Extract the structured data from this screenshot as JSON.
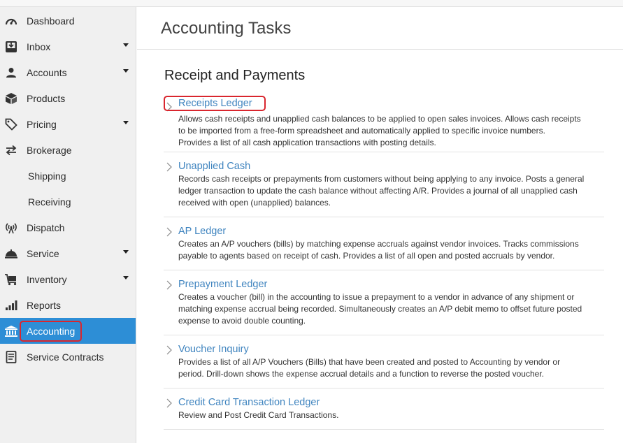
{
  "sidebar": {
    "items": [
      {
        "label": "Dashboard",
        "icon": "dashboard-gauge-icon"
      },
      {
        "label": "Inbox",
        "icon": "inbox-icon"
      },
      {
        "label": "Accounts",
        "icon": "person-icon"
      },
      {
        "label": "Products",
        "icon": "box-icon"
      },
      {
        "label": "Pricing",
        "icon": "price-tag-icon"
      },
      {
        "label": "Brokerage",
        "icon": "exchange-arrows-icon"
      },
      {
        "label": "Shipping"
      },
      {
        "label": "Receiving"
      },
      {
        "label": "Dispatch",
        "icon": "antenna-icon"
      },
      {
        "label": "Service",
        "icon": "service-bell-icon"
      },
      {
        "label": "Inventory",
        "icon": "cart-icon"
      },
      {
        "label": "Reports",
        "icon": "bar-chart-icon"
      },
      {
        "label": "Accounting",
        "icon": "bank-icon"
      },
      {
        "label": "Service Contracts",
        "icon": "contract-icon"
      }
    ]
  },
  "header": {
    "title": "Accounting Tasks"
  },
  "section": {
    "title": "Receipt and Payments"
  },
  "tasks": [
    {
      "title": "Receipts Ledger",
      "lines": [
        "Allows cash receipts and unapplied cash balances to be applied to open sales invoices. Allows cash receipts",
        "to be imported from a free-form spreadsheet and automatically applied to specific invoice numbers.",
        "Provides a list of all cash application transactions with posting details."
      ]
    },
    {
      "title": "Unapplied Cash",
      "lines": [
        "Records cash receipts or prepayments from customers without being applying to any invoice. Posts a general",
        "ledger transaction to update the cash balance without affecting A/R. Provides a journal of all unapplied cash",
        "received with open (unapplied) balances."
      ]
    },
    {
      "title": "AP Ledger",
      "lines": [
        "Creates an A/P vouchers (bills) by matching expense accruals against vendor invoices. Tracks commissions",
        "payable to agents based on receipt of cash. Provides a list of all open and posted accruals by vendor."
      ]
    },
    {
      "title": "Prepayment Ledger",
      "lines": [
        "Creates a voucher (bill) in the accounting to issue a prepayment to a vendor in advance of any shipment or",
        "matching expense accrual being recorded. Simultaneously creates an A/P debit memo to offset future posted",
        "expense to avoid double counting."
      ]
    },
    {
      "title": "Voucher Inquiry",
      "lines": [
        "Provides a list of all A/P Vouchers (Bills) that have been created and posted to Accounting by vendor or",
        "period. Drill-down shows the expense accrual details and a function to reverse the posted voucher."
      ]
    },
    {
      "title": "Credit Card Transaction Ledger",
      "lines": [
        "Review and Post Credit Card Transactions."
      ]
    }
  ],
  "colors": {
    "accent": "#2d8ed6",
    "link": "#3f84bf",
    "highlight": "#d9262e"
  }
}
